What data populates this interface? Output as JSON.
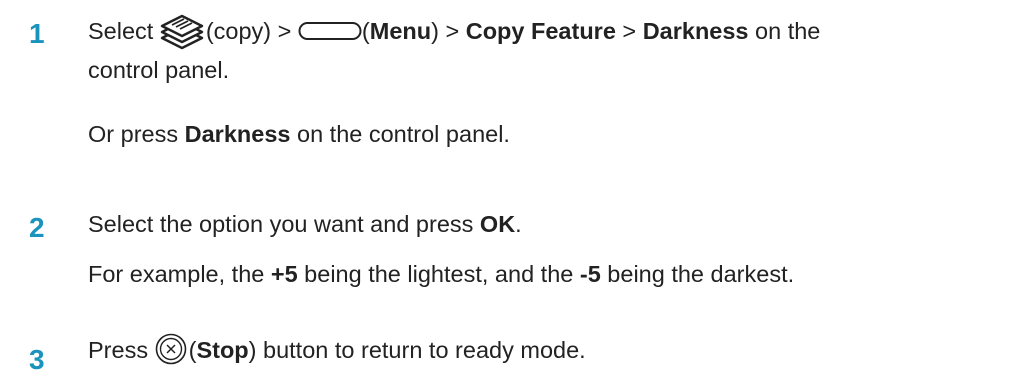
{
  "steps": [
    {
      "number": "1",
      "line1": {
        "t1": "Select ",
        "copy_icon": "copy-icon",
        "t2": "(copy) > ",
        "menu_icon": "menu-button-icon",
        "t3": "(",
        "b1": "Menu",
        "t4": ") > ",
        "b2": "Copy Feature",
        "t5": " > ",
        "b3": "Darkness",
        "t6": " on the"
      },
      "line2": "control panel.",
      "alt": {
        "t1": "Or press ",
        "b1": "Darkness",
        "t2": " on the control panel."
      }
    },
    {
      "number": "2",
      "main": {
        "t1": "Select the option you want and press ",
        "b1": "OK",
        "t2": "."
      },
      "example": {
        "t1": "For example, the ",
        "b1": "+5",
        "t2": " being the lightest, and the ",
        "b2": "-5",
        "t3": " being the darkest."
      }
    },
    {
      "number": "3",
      "main": {
        "t1": "Press ",
        "stop_icon": "stop-button-icon",
        "t2": "(",
        "b1": "Stop",
        "t3": ") button to return to ready mode."
      }
    }
  ],
  "colors": {
    "step_number": "#1a93bd",
    "text": "#222222"
  }
}
